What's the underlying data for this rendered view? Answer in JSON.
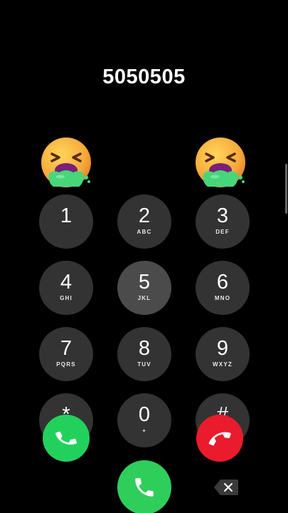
{
  "dialer": {
    "number": "5050505"
  },
  "keypad": [
    {
      "digit": "1",
      "letters": ""
    },
    {
      "digit": "2",
      "letters": "ABC"
    },
    {
      "digit": "3",
      "letters": "DEF"
    },
    {
      "digit": "4",
      "letters": "GHI"
    },
    {
      "digit": "5",
      "letters": "JKL"
    },
    {
      "digit": "6",
      "letters": "MNO"
    },
    {
      "digit": "7",
      "letters": "PQRS"
    },
    {
      "digit": "8",
      "letters": "TUV"
    },
    {
      "digit": "9",
      "letters": "WXYZ"
    },
    {
      "digit": "*",
      "letters": ""
    },
    {
      "digit": "0",
      "letters": "+"
    },
    {
      "digit": "#",
      "letters": ""
    }
  ],
  "stickers": {
    "left": "vomiting-face-emoji",
    "right": "vomiting-face-emoji"
  },
  "colors": {
    "background": "#000000",
    "key": "#333333",
    "key_pressed": "#4b4b4b",
    "accept": "#22d15c",
    "decline": "#ea1b2c",
    "call": "#2fce5b"
  },
  "icons": {
    "accept": "phone-icon",
    "decline": "hang-up-icon",
    "call": "phone-icon",
    "backspace": "backspace-icon"
  }
}
